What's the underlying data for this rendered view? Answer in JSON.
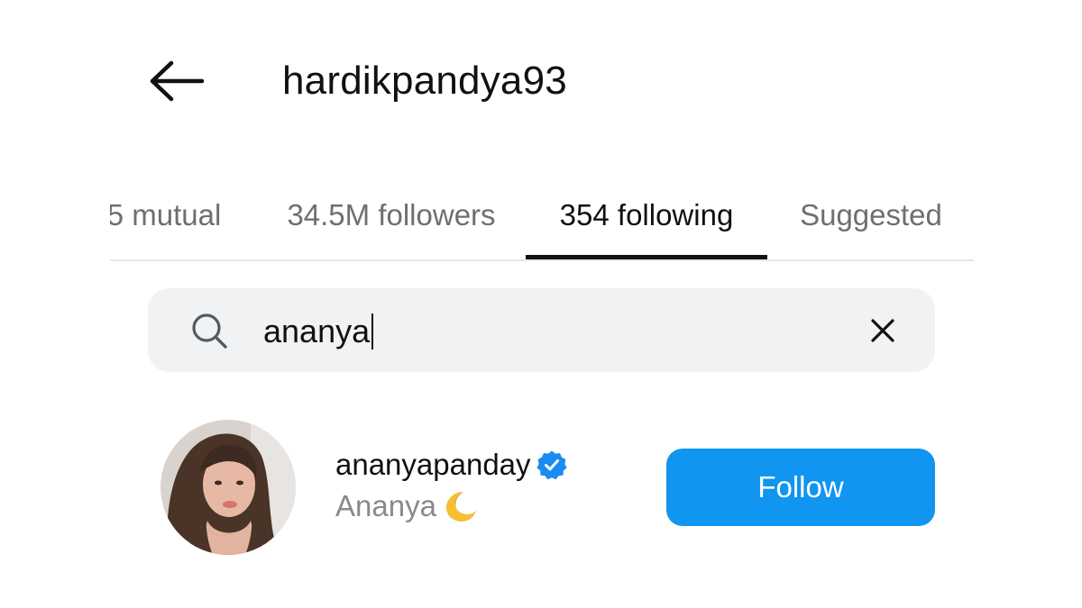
{
  "header": {
    "title": "hardikpandya93",
    "back_icon": "arrow-left-icon"
  },
  "tabs": [
    {
      "label": "5 mutual",
      "active": false
    },
    {
      "label": "34.5M followers",
      "active": false
    },
    {
      "label": "354 following",
      "active": true
    },
    {
      "label": "Suggested",
      "active": false
    }
  ],
  "search": {
    "value": "ananya",
    "search_icon": "search-icon",
    "clear_icon": "close-icon"
  },
  "results": [
    {
      "username": "ananyapanday",
      "verified": true,
      "full_name": "Ananya",
      "name_emoji": "crescent-moon-icon",
      "action_label": "Follow"
    }
  ],
  "colors": {
    "accent": "#1095f0",
    "verified": "#1a8cf0",
    "inactive_text": "#6f6f6f",
    "search_bg": "#f1f2f4",
    "moon": "#f5c033"
  }
}
